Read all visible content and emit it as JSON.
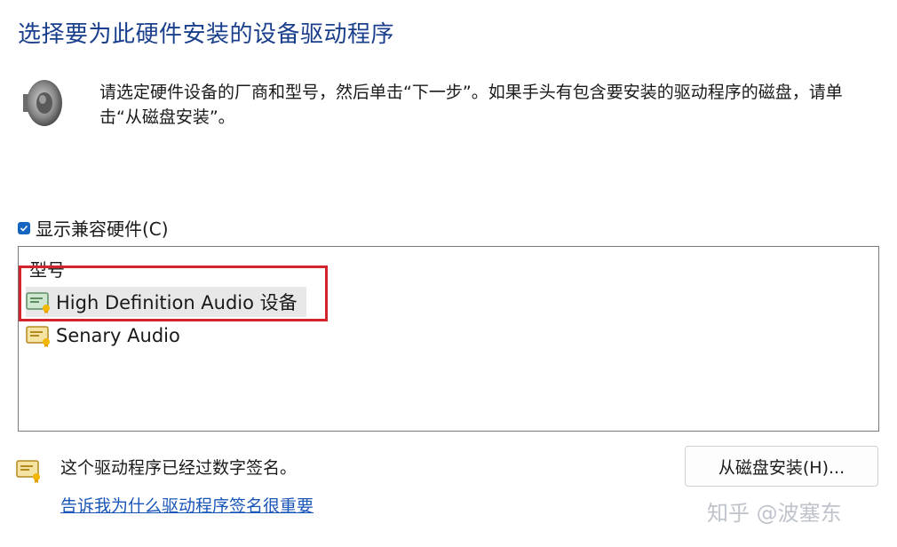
{
  "dialog": {
    "title": "选择要为此硬件安装的设备驱动程序",
    "description": "请选定硬件设备的厂商和型号，然后单击“下一步”。如果手头有包含要安装的驱动程序的磁盘，请单击“从磁盘安装”。"
  },
  "compat": {
    "label": "显示兼容硬件(C)",
    "checked": true
  },
  "model_list": {
    "header": "型号",
    "items": [
      {
        "label": "High Definition Audio 设备",
        "selected": true
      },
      {
        "label": "Senary Audio",
        "selected": false
      }
    ]
  },
  "footer": {
    "signed_text": "这个驱动程序已经过数字签名。",
    "why_link": "告诉我为什么驱动程序签名很重要",
    "disk_button": "从磁盘安装(H)..."
  },
  "watermark": "知乎 @波塞东",
  "colors": {
    "title": "#1a3f8c",
    "link": "#1a56b8",
    "highlight": "#d3242b",
    "checkbox": "#1565c0"
  }
}
